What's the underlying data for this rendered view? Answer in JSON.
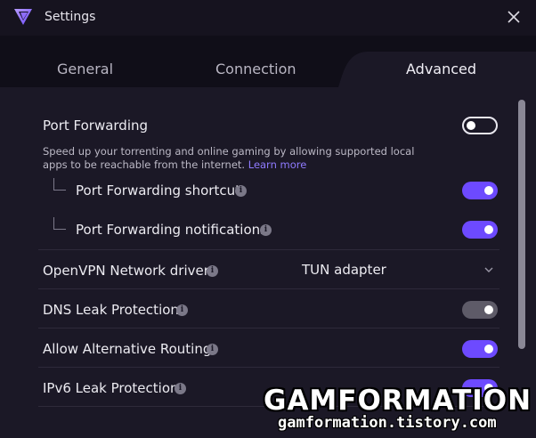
{
  "window": {
    "title": "Settings",
    "logo_icon": "proton-vpn-logo-icon",
    "close_icon": "close-icon"
  },
  "tabs": [
    {
      "label": "General",
      "active": false
    },
    {
      "label": "Connection",
      "active": false
    },
    {
      "label": "Advanced",
      "active": true
    }
  ],
  "settings": {
    "port_forwarding": {
      "label": "Port Forwarding",
      "enabled": false,
      "description": "Speed up your torrenting and online gaming by allowing supported local apps to be reachable from the internet.",
      "learn_more": "Learn more"
    },
    "port_forwarding_shortcut": {
      "label": "Port Forwarding shortcut",
      "enabled": true
    },
    "port_forwarding_notifications": {
      "label": "Port Forwarding notifications",
      "enabled": true
    },
    "openvpn_driver": {
      "label": "OpenVPN Network driver",
      "value": "TUN adapter"
    },
    "dns_leak_protection": {
      "label": "DNS Leak Protection",
      "enabled": true,
      "locked": true
    },
    "alternative_routing": {
      "label": "Allow Alternative Routing",
      "enabled": true
    },
    "ipv6_leak_protection": {
      "label": "IPv6 Leak Protection",
      "enabled": true
    }
  },
  "info_glyph": "i",
  "watermark": {
    "title": "GAMFORMATION",
    "subtitle": "gamformation.tistory.com"
  },
  "colors": {
    "accent": "#6d4aff",
    "background": "#1b1826",
    "titlebar": "#16131f",
    "tabbar": "#100e18",
    "toggle_disabled": "#5e5b68"
  }
}
